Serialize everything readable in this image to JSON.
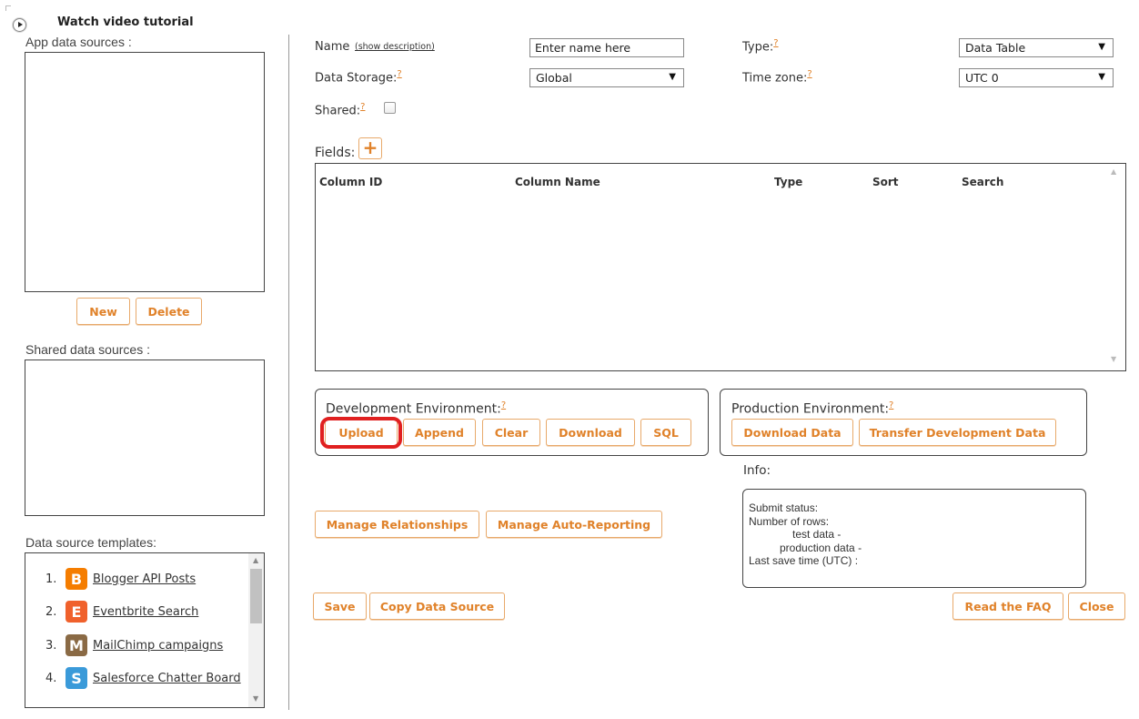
{
  "header": {
    "tutorial_label": "Watch video tutorial"
  },
  "left": {
    "app_sources_label": "App data sources :",
    "new_label": "New",
    "delete_label": "Delete",
    "shared_sources_label": "Shared data sources :",
    "templates_label": "Data source templates:",
    "templates": [
      {
        "num": "1.",
        "name": "Blogger API Posts",
        "icon": "blogger-icon",
        "color": "#f57d00",
        "glyph": "B"
      },
      {
        "num": "2.",
        "name": "Eventbrite Search",
        "icon": "eventbrite-icon",
        "color": "#f0612c",
        "glyph": "E"
      },
      {
        "num": "3.",
        "name": "MailChimp campaigns",
        "icon": "mailchimp-icon",
        "color": "#8a6a45",
        "glyph": "M"
      },
      {
        "num": "4.",
        "name": "Salesforce Chatter Board",
        "icon": "salesforce-icon",
        "color": "#3a9ad9",
        "glyph": "S"
      }
    ]
  },
  "form": {
    "name_label": "Name",
    "show_description": "(show description)",
    "name_value": "Enter name here",
    "type_label": "Type:",
    "type_value": "Data Table",
    "storage_label": "Data Storage:",
    "storage_value": "Global",
    "timezone_label": "Time zone:",
    "timezone_value": "UTC 0",
    "shared_label": "Shared:",
    "help_mark": "?",
    "shared_checked": false
  },
  "fields": {
    "label": "Fields:",
    "add_glyph": "+",
    "columns": [
      "Column ID",
      "Column Name",
      "Type",
      "Sort",
      "Search"
    ]
  },
  "dev_env": {
    "label": "Development Environment:",
    "buttons": [
      "Upload",
      "Append",
      "Clear",
      "Download",
      "SQL"
    ]
  },
  "prod_env": {
    "label": "Production Environment:",
    "buttons": [
      "Download Data",
      "Transfer Development Data"
    ]
  },
  "info": {
    "label": "Info:",
    "lines": [
      "Submit status:",
      "Number of rows:",
      "test data -",
      "production data -",
      "Last save time (UTC) :"
    ]
  },
  "actions": {
    "manage_relationships": "Manage Relationships",
    "manage_auto_reporting": "Manage Auto-Reporting",
    "save": "Save",
    "copy_data_source": "Copy Data Source",
    "read_faq": "Read the FAQ",
    "close": "Close"
  },
  "colors": {
    "accent": "#e0822a",
    "highlight": "#e02020"
  }
}
